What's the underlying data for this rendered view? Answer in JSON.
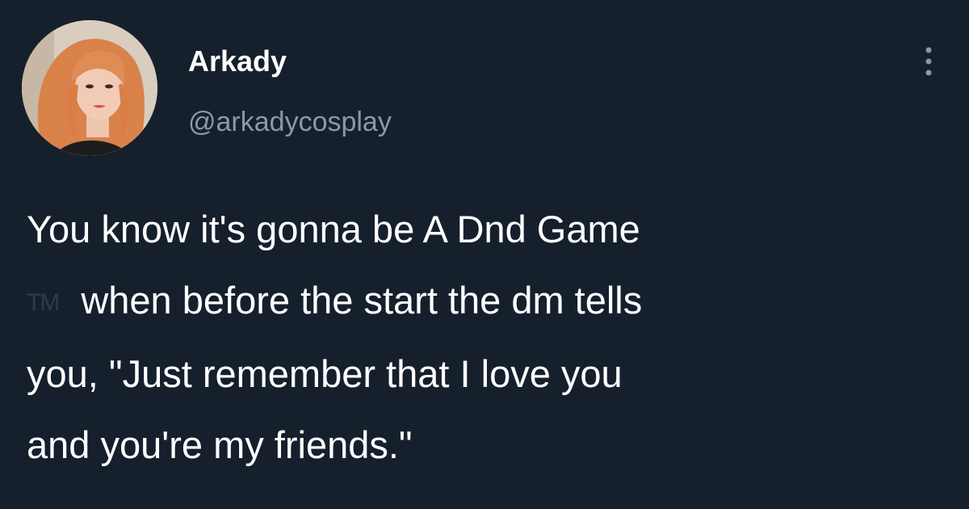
{
  "user": {
    "display_name": "Arkady",
    "handle": "@arkadycosplay",
    "avatar": "profile-photo-icon"
  },
  "menu": {
    "icon": "more-options-icon"
  },
  "tweet": {
    "line1": "You know it's gonna be A Dnd Game",
    "trademark": "TM",
    "line2": "when before the start the dm tells",
    "line3": "you, \"Just remember that I love you",
    "line4": "and you're my friends.\""
  },
  "colors": {
    "background": "#16202c",
    "text": "#ffffff",
    "secondary_text": "#8b98a5"
  }
}
